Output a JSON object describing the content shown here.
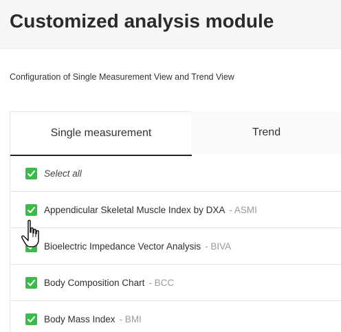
{
  "header": {
    "title": "Customized analysis module"
  },
  "subtitle": "Configuration of Single Measurement View and Trend View",
  "tabs": [
    {
      "label": "Single measurement",
      "active": true
    },
    {
      "label": "Trend",
      "active": false
    }
  ],
  "list": {
    "select_all": {
      "label": "Select all",
      "checked": true
    },
    "items": [
      {
        "label": "Appendicular Skeletal Muscle Index by DXA",
        "abbr": "- ASMI",
        "checked": true
      },
      {
        "label": "Bioelectric Impedance Vector Analysis",
        "abbr": "- BIVA",
        "checked": true
      },
      {
        "label": "Body Composition Chart",
        "abbr": "- BCC",
        "checked": true
      },
      {
        "label": "Body Mass Index",
        "abbr": "- BMI",
        "checked": true
      }
    ]
  },
  "colors": {
    "checkbox": "#3dbb4a",
    "header_bg": "#f5f6f8",
    "active_tab_underline": "#222222"
  },
  "icons": {
    "checkbox": "checkmark-icon",
    "cursor": "hand-pointer-icon"
  }
}
